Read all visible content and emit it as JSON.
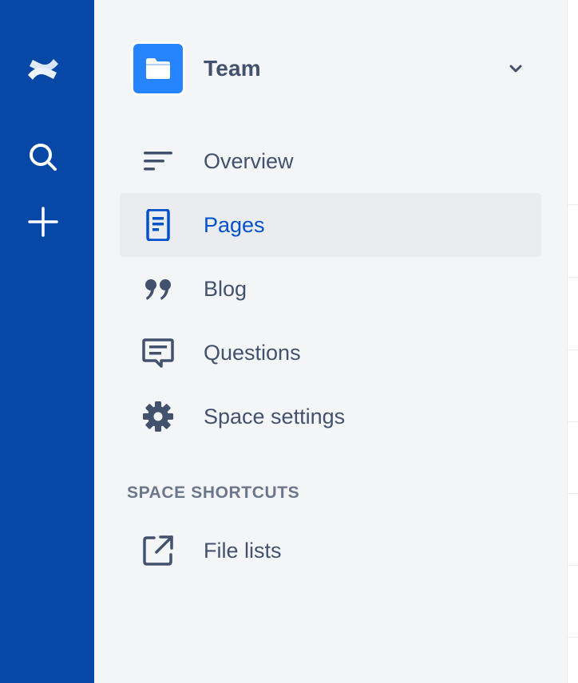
{
  "global_nav": {
    "logo_icon": "confluence-logo-icon",
    "search_icon": "search-icon",
    "create_icon": "plus-icon"
  },
  "space": {
    "name": "Team",
    "avatar_icon": "folder-icon",
    "menu_icon": "chevron-down-icon"
  },
  "nav": {
    "items": [
      {
        "label": "Overview",
        "icon": "overview-lines-icon",
        "selected": false
      },
      {
        "label": "Pages",
        "icon": "page-icon",
        "selected": true
      },
      {
        "label": "Blog",
        "icon": "quote-icon",
        "selected": false
      },
      {
        "label": "Questions",
        "icon": "speech-bubble-icon",
        "selected": false
      },
      {
        "label": "Space settings",
        "icon": "gear-icon",
        "selected": false
      }
    ]
  },
  "shortcuts": {
    "heading": "SPACE SHORTCUTS",
    "items": [
      {
        "label": "File lists",
        "icon": "external-link-icon"
      }
    ]
  },
  "colors": {
    "global_nav_bg": "#0747A6",
    "sidebar_bg": "#F4F5F7",
    "selected_bg": "#EBECF0",
    "selected_text": "#0052CC",
    "text": "#42526E",
    "heading_text": "#6B778C",
    "space_avatar": "#2684FF"
  }
}
